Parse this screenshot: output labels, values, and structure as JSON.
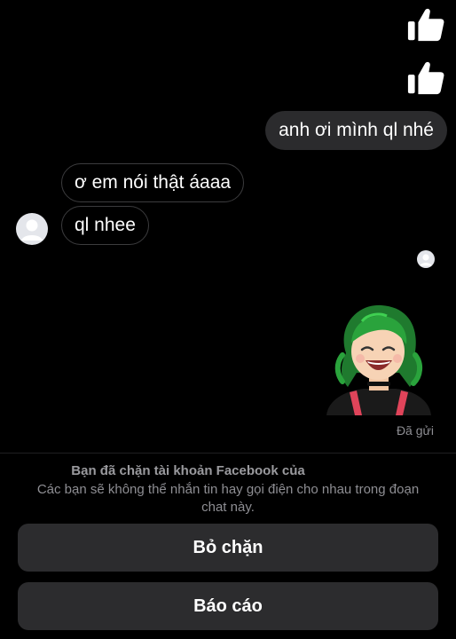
{
  "messages": {
    "outgoing_text": "anh ơi mình ql nhé",
    "incoming": [
      "ơ em nói thật áaaa",
      "ql nhee"
    ],
    "status": "Đã gửi"
  },
  "icons": {
    "like": "thumbs-up-icon",
    "avatar": "default-avatar-icon",
    "seen": "seen-avatar-icon",
    "sticker": "avatar-sticker"
  },
  "notice": {
    "title": "Bạn đã chặn tài khoản Facebook của",
    "body": "Các bạn sẽ không thể nhắn tin hay gọi điện cho nhau trong đoạn chat này."
  },
  "actions": {
    "unblock_label": "Bỏ chặn",
    "report_label": "Báo cáo"
  },
  "colors": {
    "background": "#000000",
    "outgoing_bubble": "#2b2b2d",
    "button_bg": "#2c2c2e",
    "muted_text": "#8e8e93"
  }
}
